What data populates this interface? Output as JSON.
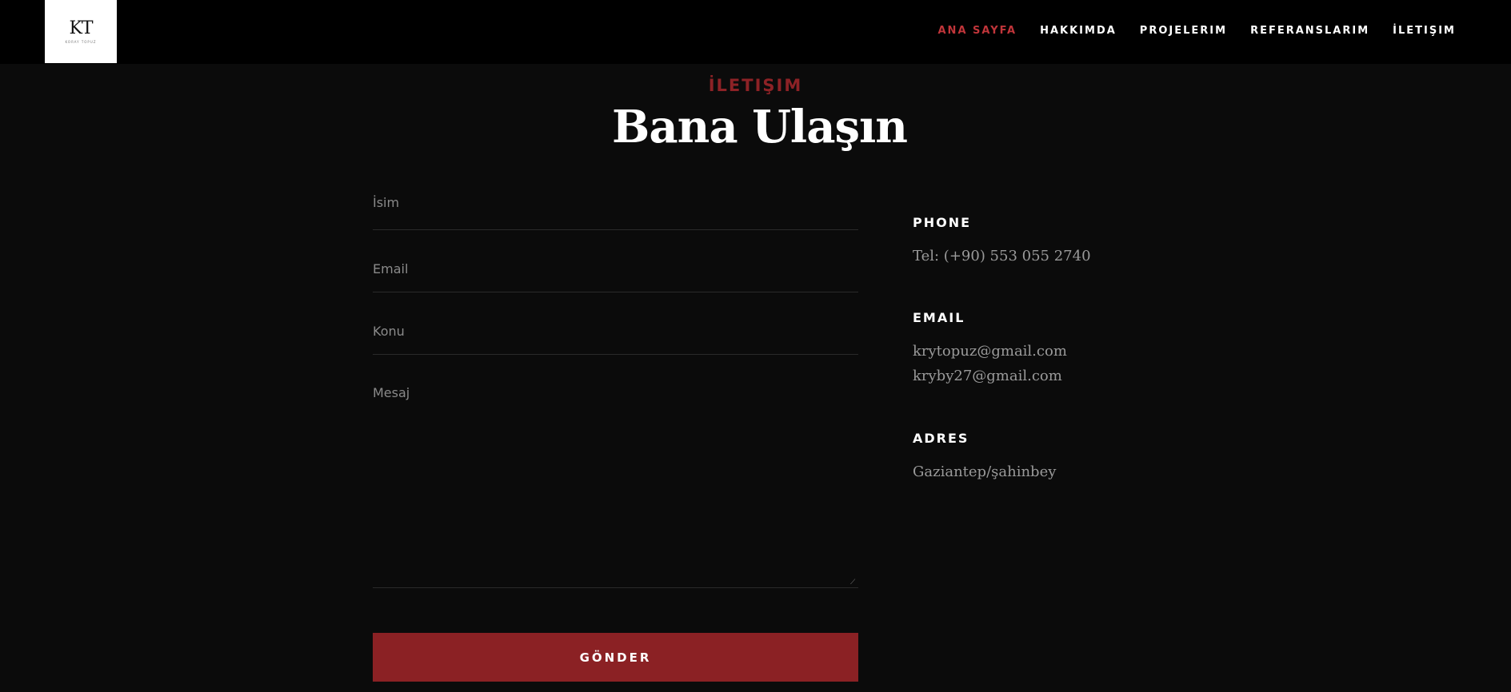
{
  "header": {
    "logo": {
      "mark": "KT",
      "subtitle": "KORAY TOPUZ"
    },
    "nav": [
      {
        "label": "ANA SAYFA",
        "active": true
      },
      {
        "label": "HAKKIMDA",
        "active": false
      },
      {
        "label": "PROJELERIM",
        "active": false
      },
      {
        "label": "REFERANSLARIM",
        "active": false
      },
      {
        "label": "İLETIŞIM",
        "active": false
      }
    ]
  },
  "section": {
    "kicker": "İLETIŞIM",
    "title": "Bana Ulaşın"
  },
  "form": {
    "name_placeholder": "İsim",
    "email_placeholder": "Email",
    "subject_placeholder": "Konu",
    "message_placeholder": "Mesaj",
    "submit_label": "GÖNDER"
  },
  "contact": {
    "phone": {
      "label": "PHONE",
      "value": "Tel: (+90) 553 055 2740"
    },
    "email": {
      "label": "EMAIL",
      "values": [
        "krytopuz@gmail.com",
        "kryby27@gmail.com"
      ]
    },
    "address": {
      "label": "ADRES",
      "value": "Gaziantep/şahinbey"
    }
  },
  "colors": {
    "accent": "#8b2124",
    "nav_active": "#c0353a",
    "background": "#0b0b0b",
    "header_bg": "#000000"
  }
}
